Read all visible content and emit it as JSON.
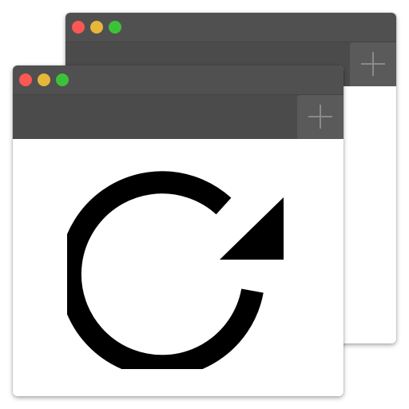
{
  "windows": [
    {
      "name": "back",
      "controls": [
        "close",
        "minimize",
        "zoom"
      ],
      "new_tab_icon": "plus-icon"
    },
    {
      "name": "front",
      "controls": [
        "close",
        "minimize",
        "zoom"
      ],
      "new_tab_icon": "plus-icon",
      "content_icon": "reload-icon"
    }
  ],
  "colors": {
    "close": "#fc5753",
    "minimize": "#e7b73a",
    "zoom": "#3cc23a",
    "titlebar": "#505050",
    "tabbar": "#4b4b4b",
    "content": "#ffffff",
    "icon": "#000000"
  }
}
